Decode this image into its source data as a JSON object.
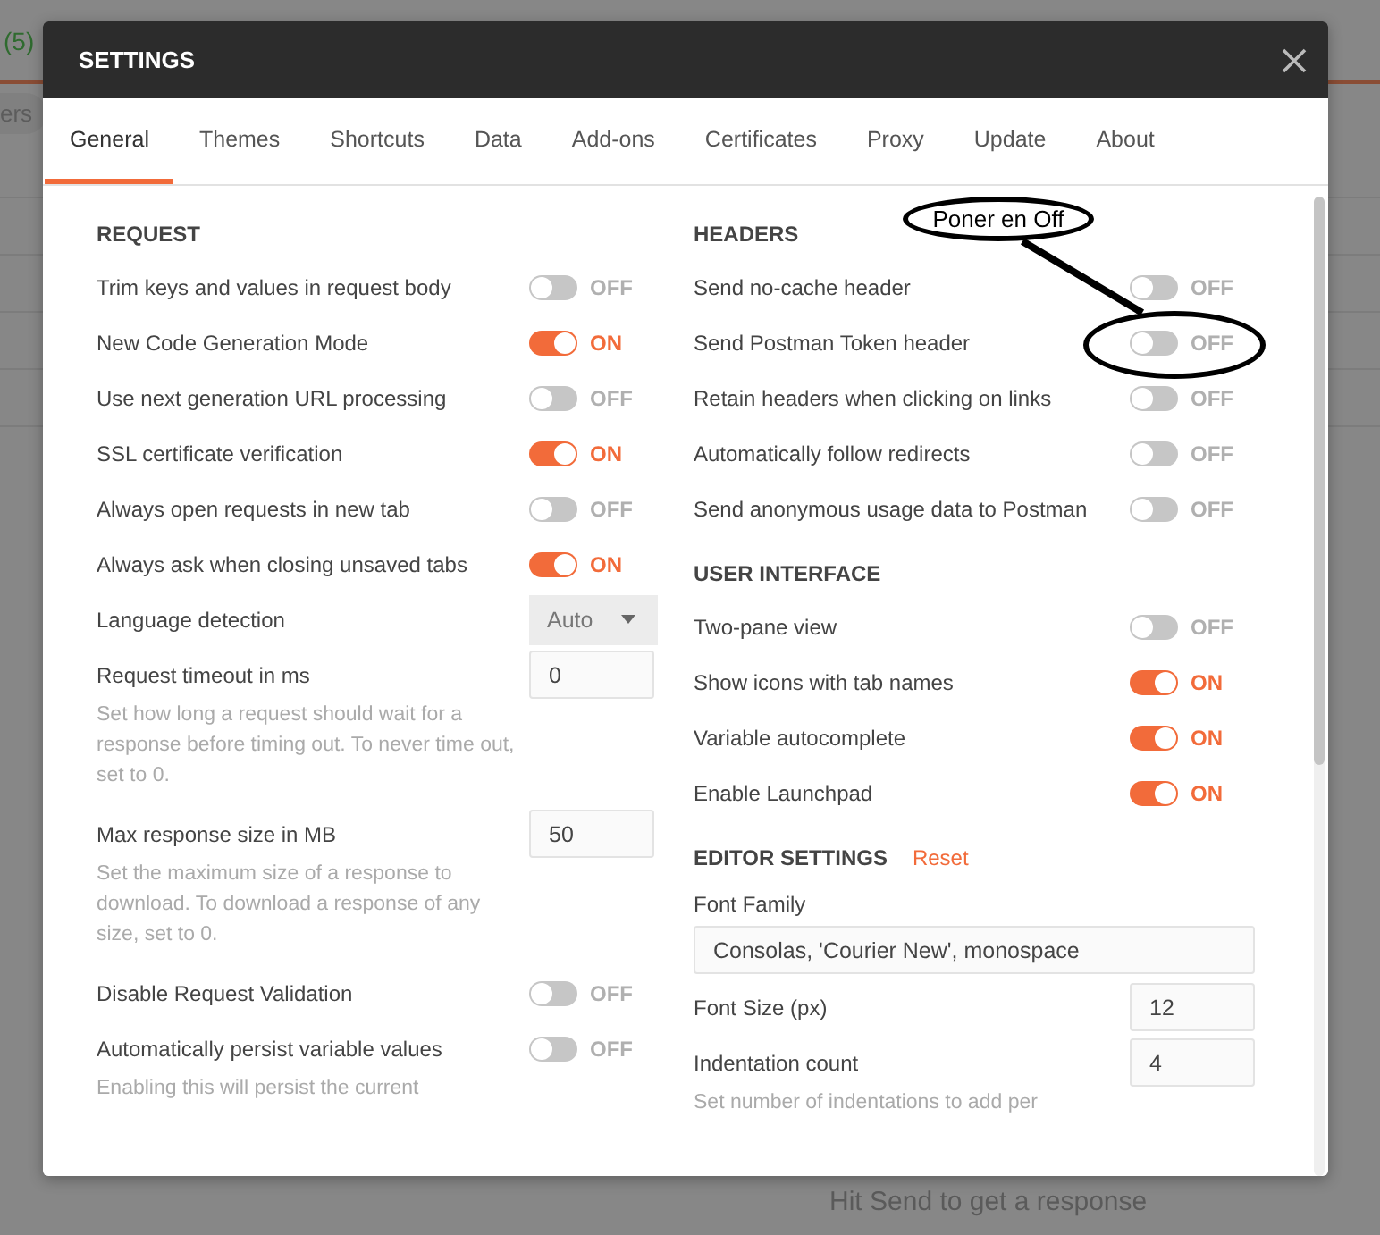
{
  "background": {
    "tab_count": "(5)",
    "filter_text": "ers",
    "hint": "Hit Send to get a response"
  },
  "window": {
    "title": "SETTINGS"
  },
  "tabs": [
    {
      "label": "General",
      "selected": true
    },
    {
      "label": "Themes",
      "selected": false
    },
    {
      "label": "Shortcuts",
      "selected": false
    },
    {
      "label": "Data",
      "selected": false
    },
    {
      "label": "Add-ons",
      "selected": false
    },
    {
      "label": "Certificates",
      "selected": false
    },
    {
      "label": "Proxy",
      "selected": false
    },
    {
      "label": "Update",
      "selected": false
    },
    {
      "label": "About",
      "selected": false
    }
  ],
  "columns": [
    {
      "sections": [
        {
          "title": "REQUEST",
          "settings": [
            {
              "kind": "toggle",
              "label": "Trim keys and values in request body",
              "on": false,
              "state_label": "OFF"
            },
            {
              "kind": "toggle",
              "label": "New Code Generation Mode",
              "on": true,
              "state_label": "ON"
            },
            {
              "kind": "toggle",
              "label": "Use next generation URL processing",
              "on": false,
              "state_label": "OFF"
            },
            {
              "kind": "toggle",
              "label": "SSL certificate verification",
              "on": true,
              "state_label": "ON"
            },
            {
              "kind": "toggle",
              "label": "Always open requests in new tab",
              "on": false,
              "state_label": "OFF"
            },
            {
              "kind": "toggle",
              "label": "Always ask when closing unsaved tabs",
              "on": true,
              "state_label": "ON"
            },
            {
              "kind": "select",
              "label": "Language detection",
              "value": "Auto"
            },
            {
              "kind": "number",
              "label": "Request timeout in ms",
              "value": "0",
              "description": "Set how long a request should wait for a response before timing out. To never time out, set to 0."
            },
            {
              "kind": "number",
              "label": "Max response size in MB",
              "value": "50",
              "description": "Set the maximum size of a response to download. To download a response of any size, set to 0."
            },
            {
              "kind": "toggle",
              "label": "Disable Request Validation",
              "on": false,
              "state_label": "OFF"
            },
            {
              "kind": "toggle",
              "label": "Automatically persist variable values",
              "on": false,
              "state_label": "OFF",
              "description": "Enabling this will persist the current"
            }
          ]
        }
      ]
    },
    {
      "sections": [
        {
          "title": "HEADERS",
          "settings": [
            {
              "kind": "toggle",
              "label": "Send no-cache header",
              "on": false,
              "state_label": "OFF"
            },
            {
              "kind": "toggle",
              "label": "Send Postman Token header",
              "on": false,
              "state_label": "OFF"
            },
            {
              "kind": "toggle",
              "label": "Retain headers when clicking on links",
              "on": false,
              "state_label": "OFF"
            },
            {
              "kind": "toggle",
              "label": "Automatically follow redirects",
              "on": false,
              "state_label": "OFF"
            },
            {
              "kind": "toggle",
              "label": "Send anonymous usage data to Postman",
              "on": false,
              "state_label": "OFF"
            }
          ]
        },
        {
          "title": "USER INTERFACE",
          "settings": [
            {
              "kind": "toggle",
              "label": "Two-pane view",
              "on": false,
              "state_label": "OFF"
            },
            {
              "kind": "toggle",
              "label": "Show icons with tab names",
              "on": true,
              "state_label": "ON"
            },
            {
              "kind": "toggle",
              "label": "Variable autocomplete",
              "on": true,
              "state_label": "ON"
            },
            {
              "kind": "toggle",
              "label": "Enable Launchpad",
              "on": true,
              "state_label": "ON"
            }
          ]
        },
        {
          "title": "EDITOR SETTINGS",
          "action": "Reset",
          "settings": [
            {
              "kind": "text",
              "label": "Font Family",
              "value": "Consolas, 'Courier New', monospace"
            },
            {
              "kind": "number",
              "label": "Font Size (px)",
              "value": "12"
            },
            {
              "kind": "number",
              "label": "Indentation count",
              "value": "4",
              "description": "Set number of indentations to add per"
            }
          ]
        }
      ]
    }
  ],
  "annotation": {
    "text": "Poner en Off"
  }
}
